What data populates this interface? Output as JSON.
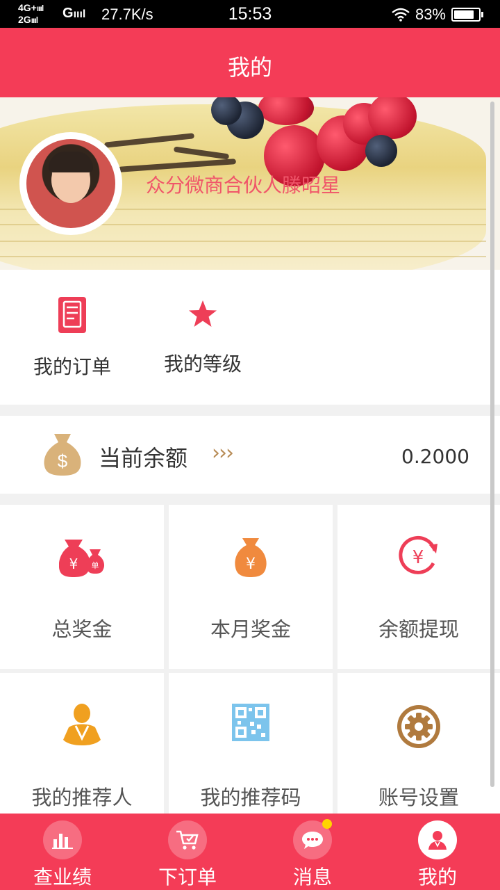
{
  "status_bar": {
    "network_top": "4G+",
    "network_bottom": "2G",
    "network_type": "G",
    "speed": "27.7K/s",
    "time": "15:53",
    "battery": "83%",
    "battery_level": 0.83
  },
  "header": {
    "title": "我的"
  },
  "banner": {
    "username": "众分微商合伙人滕昭星"
  },
  "quick_links": [
    {
      "label": "我的订单",
      "icon": "order-document-icon"
    },
    {
      "label": "我的等级",
      "icon": "star-icon"
    }
  ],
  "balance": {
    "label": "当前余额",
    "arrows": "›››",
    "value": "0.2000",
    "icon": "money-bag-icon"
  },
  "grid": [
    {
      "label": "总奖金",
      "icon": "money-bags-icon"
    },
    {
      "label": "本月奖金",
      "icon": "money-bag-icon"
    },
    {
      "label": "余额提现",
      "icon": "yuan-refresh-icon"
    },
    {
      "label": "我的推荐人",
      "icon": "referrer-person-icon"
    },
    {
      "label": "我的推荐码",
      "icon": "qr-code-icon"
    },
    {
      "label": "账号设置",
      "icon": "gear-icon"
    }
  ],
  "tabs": [
    {
      "label": "查业绩",
      "icon": "bar-chart-icon"
    },
    {
      "label": "下订单",
      "icon": "cart-icon"
    },
    {
      "label": "消息",
      "icon": "message-icon",
      "badge": true
    },
    {
      "label": "我的",
      "icon": "user-icon",
      "active": true
    }
  ],
  "colors": {
    "brand": "#f43c57",
    "badge": "#ffd400",
    "balance_accent": "#b78b55"
  }
}
